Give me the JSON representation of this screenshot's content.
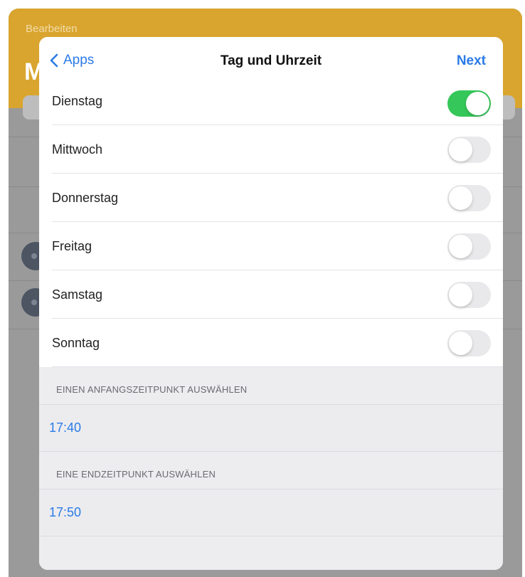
{
  "background": {
    "edit_label": "Bearbeiten",
    "title_partial": "M"
  },
  "nav": {
    "back_label": "Apps",
    "title": "Tag und Uhrzeit",
    "next_label": "Next"
  },
  "days": [
    {
      "label": "Dienstag",
      "on": true
    },
    {
      "label": "Mittwoch",
      "on": false
    },
    {
      "label": "Donnerstag",
      "on": false
    },
    {
      "label": "Freitag",
      "on": false
    },
    {
      "label": "Samstag",
      "on": false
    },
    {
      "label": "Sonntag",
      "on": false
    }
  ],
  "start": {
    "header": "EINEN ANFANGSZEITPUNKT AUSWÄHLEN",
    "value": "17:40"
  },
  "end": {
    "header": "EINE ENDZEITPUNKT AUSWÄHLEN",
    "value": "17:50"
  },
  "colors": {
    "accent": "#2b7be6",
    "toggle_on": "#35c759",
    "header_bar": "#d9a52e"
  }
}
